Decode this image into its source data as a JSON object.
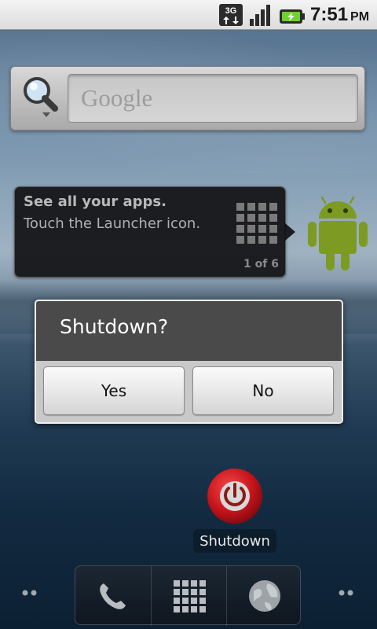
{
  "status_bar": {
    "network_icon": "3g-data-icon",
    "signal_icon": "signal-strength-icon",
    "battery_icon": "battery-charging-icon",
    "time": "7:51",
    "ampm": "PM",
    "accent_color": "#6fd12f"
  },
  "search_widget": {
    "icon": "search-icon",
    "placeholder": "Google"
  },
  "launcher_tip": {
    "title": "See all your apps.",
    "text": "Touch the Launcher icon.",
    "page": "1 of 6",
    "icon": "launcher-grid-icon",
    "mascot_icon": "android-robot-icon"
  },
  "dialog": {
    "title": "Shutdown?",
    "yes_label": "Yes",
    "no_label": "No"
  },
  "shortcut": {
    "icon": "power-icon",
    "label": "Shutdown",
    "color": "#c8141c"
  },
  "dock": {
    "items": [
      {
        "icon": "phone-icon"
      },
      {
        "icon": "launcher-grid-icon"
      },
      {
        "icon": "browser-globe-icon"
      }
    ]
  }
}
